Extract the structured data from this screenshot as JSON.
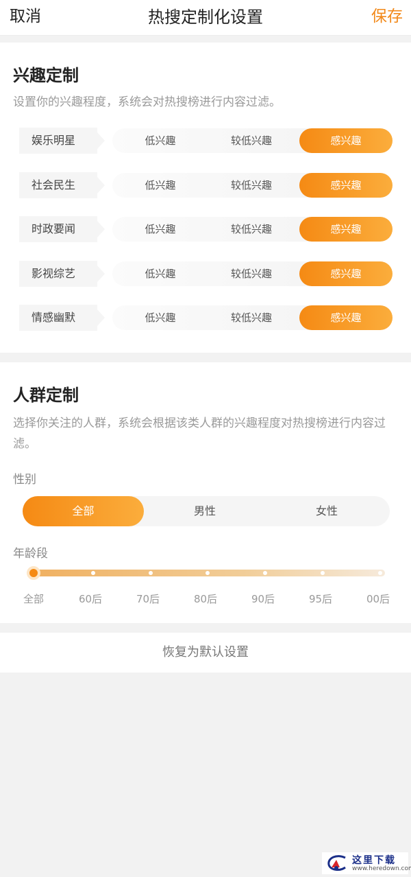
{
  "nav": {
    "cancel": "取消",
    "title": "热搜定制化设置",
    "save": "保存"
  },
  "colors": {
    "accent": "#f58a14",
    "accent_light": "#fbad3c",
    "background": "#f2f2f2"
  },
  "interest": {
    "title": "兴趣定制",
    "desc": "设置你的兴趣程度，系统会对热搜榜进行内容过滤。",
    "options": [
      "低兴趣",
      "较低兴趣",
      "感兴趣"
    ],
    "rows": [
      {
        "label": "娱乐明星",
        "selected": "感兴趣"
      },
      {
        "label": "社会民生",
        "selected": "感兴趣"
      },
      {
        "label": "时政要闻",
        "selected": "感兴趣"
      },
      {
        "label": "影视综艺",
        "selected": "感兴趣"
      },
      {
        "label": "情感幽默",
        "selected": "感兴趣"
      }
    ]
  },
  "crowd": {
    "title": "人群定制",
    "desc": "选择你关注的人群，系统会根据该类人群的兴趣程度对热搜榜进行内容过滤。",
    "gender_label": "性别",
    "gender_options": [
      "全部",
      "男性",
      "女性"
    ],
    "gender_selected": "全部",
    "age_label": "年龄段",
    "age_options": [
      "全部",
      "60后",
      "70后",
      "80后",
      "90后",
      "95后",
      "00后"
    ],
    "age_selected": "全部"
  },
  "reset": {
    "label": "恢复为默认设置"
  },
  "watermark": {
    "title": "这里下载",
    "url": "www.heredown.com"
  }
}
